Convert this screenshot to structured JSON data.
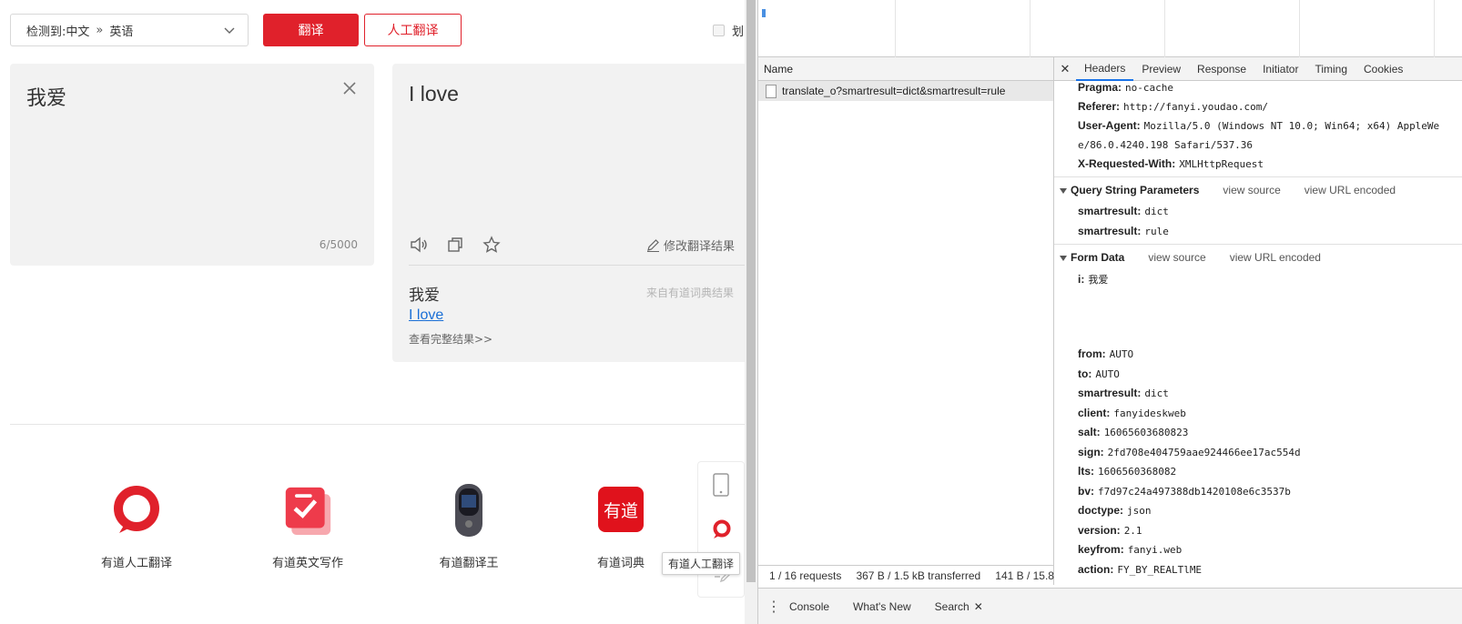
{
  "translator": {
    "detect_label": "检测到:",
    "from_lang": "中文",
    "arrow": "»",
    "to_lang": "英语",
    "translate_button": "翻译",
    "human_button": "人工翻译",
    "hua_label": "划",
    "source_text": "我爱",
    "char_count": "6/5000",
    "target_text": "I love",
    "modify_label": "修改翻译结果",
    "dict_word": "我爱",
    "dict_source": "来自有道词典结果",
    "dict_link": "I love",
    "dict_more": "查看完整结果>>"
  },
  "products": [
    {
      "label": "有道人工翻译",
      "icon": "youdao-human-translate-icon"
    },
    {
      "label": "有道英文写作",
      "icon": "youdao-writing-icon"
    },
    {
      "label": "有道翻译王",
      "icon": "youdao-translator-device-icon"
    },
    {
      "label": "有道词典",
      "icon": "youdao-dict-icon",
      "logo_text": "有道"
    }
  ],
  "float_bar": {
    "tooltip": "有道人工翻译"
  },
  "devtools": {
    "name_header": "Name",
    "request_name": "translate_o?smartresult=dict&smartresult=rule",
    "status": {
      "requests": "1 / 16 requests",
      "transferred": "367 B / 1.5 kB transferred",
      "resources": "141 B / 15.8"
    },
    "tabs": [
      "Headers",
      "Preview",
      "Response",
      "Initiator",
      "Timing",
      "Cookies"
    ],
    "headers": [
      {
        "k": "Pragma:",
        "v": "no-cache"
      },
      {
        "k": "Referer:",
        "v": "http://fanyi.youdao.com/"
      },
      {
        "k": "User-Agent:",
        "v": "Mozilla/5.0 (Windows NT 10.0; Win64; x64) AppleWe"
      },
      {
        "k": "",
        "v": "e/86.0.4240.198 Safari/537.36"
      },
      {
        "k": "X-Requested-With:",
        "v": "XMLHttpRequest"
      }
    ],
    "query_section": {
      "title": "Query String Parameters",
      "view_source": "view source",
      "view_encoded": "view URL encoded"
    },
    "query": [
      {
        "k": "smartresult:",
        "v": "dict"
      },
      {
        "k": "smartresult:",
        "v": "rule"
      }
    ],
    "form_section": {
      "title": "Form Data",
      "view_source": "view source",
      "view_encoded": "view URL encoded"
    },
    "form_first": {
      "k": "i:",
      "v": "我爱"
    },
    "form": [
      {
        "k": "from:",
        "v": "AUTO"
      },
      {
        "k": "to:",
        "v": "AUTO"
      },
      {
        "k": "smartresult:",
        "v": "dict"
      },
      {
        "k": "client:",
        "v": "fanyideskweb"
      },
      {
        "k": "salt:",
        "v": "16065603680823"
      },
      {
        "k": "sign:",
        "v": "2fd708e404759aae924466ee17ac554d"
      },
      {
        "k": "lts:",
        "v": "1606560368082"
      },
      {
        "k": "bv:",
        "v": "f7d97c24a497388db1420108e6c3537b"
      },
      {
        "k": "doctype:",
        "v": "json"
      },
      {
        "k": "version:",
        "v": "2.1"
      },
      {
        "k": "keyfrom:",
        "v": "fanyi.web"
      },
      {
        "k": "action:",
        "v": "FY_BY_REALTlME"
      }
    ],
    "drawer": {
      "console": "Console",
      "whats_new": "What's New",
      "search": "Search"
    }
  }
}
